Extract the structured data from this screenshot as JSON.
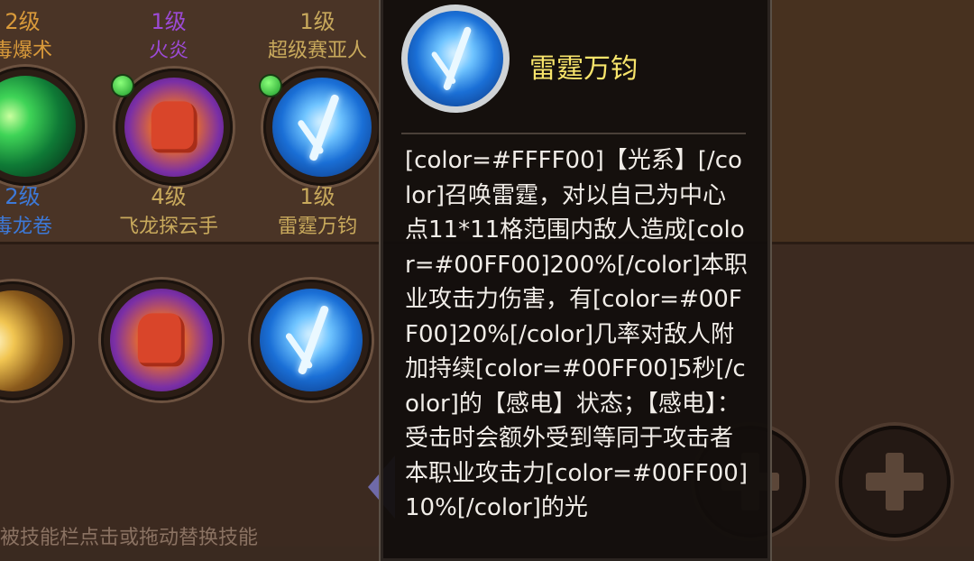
{
  "top_row_partial": [
    {
      "level": "2级",
      "name": "毒爆术"
    },
    {
      "level": "1级",
      "name": "火炎"
    },
    {
      "level": "1级",
      "name": "超级赛亚人"
    }
  ],
  "second_row": [
    {
      "level": "2级",
      "name": "毒龙卷",
      "icon": "green-tornado-icon"
    },
    {
      "level": "4级",
      "name": "飞龙探云手",
      "icon": "fist-icon"
    },
    {
      "level": "1级",
      "name": "雷霆万钧",
      "icon": "thunder-icon"
    }
  ],
  "hint": "被技能栏点击或拖动替换技能",
  "tooltip": {
    "title": "雷霆万钧",
    "description": "[color=#FFFF00]【光系】[/color]召唤雷霆，对以自己为中心点11*11格范围内敌人造成[color=#00FF00]200%[/color]本职业攻击力伤害，有[color=#00FF00]20%[/color]几率对敌人附加持续[color=#00FF00]5秒[/color]的【感电】状态；【感电】：受击时会额外受到等同于攻击者本职业攻击力[color=#00FF00]10%[/color]的光"
  },
  "colors": {
    "title": "#f7e46b",
    "level_orange": "#d99a3a",
    "level_purple": "#9c4ad6",
    "level_gold": "#c8a95c",
    "level_blue": "#3d79d8"
  }
}
